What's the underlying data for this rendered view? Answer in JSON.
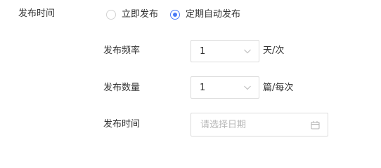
{
  "publish": {
    "label": "发布时间",
    "options": [
      {
        "label": "立即发布",
        "checked": false
      },
      {
        "label": "定期自动发布",
        "checked": true
      }
    ]
  },
  "schedule": {
    "frequency": {
      "label": "发布频率",
      "value": "1",
      "unit": "天/次"
    },
    "quantity": {
      "label": "发布数量",
      "value": "1",
      "unit": "篇/每次"
    },
    "time": {
      "label": "发布时间",
      "placeholder": "请选择日期",
      "value": ""
    }
  },
  "colors": {
    "accent": "#4a7bf7",
    "border": "#dcdcdc",
    "placeholder": "#b8b8b8"
  },
  "icons": {
    "select_arrow": "chevron-down-icon",
    "date_picker": "calendar-icon"
  }
}
